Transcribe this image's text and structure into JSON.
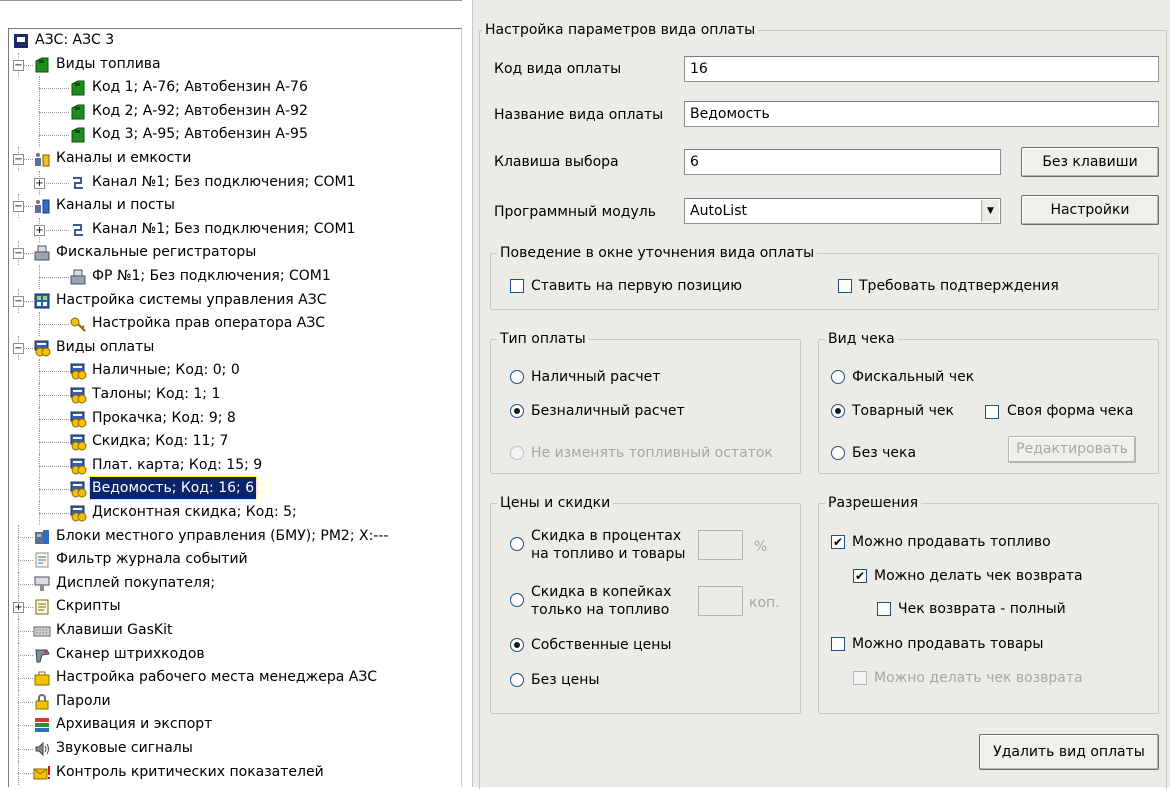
{
  "tree": {
    "items": [
      {
        "label": "АЗС: АЗС 3",
        "icon": "station-icon"
      },
      {
        "label": "Виды топлива",
        "icon": "fuel-can-icon"
      },
      {
        "label": "Код 1; А-76; Автобензин А-76",
        "icon": "fuel-can-icon"
      },
      {
        "label": "Код 2; А-92; Автобензин А-92",
        "icon": "fuel-can-icon"
      },
      {
        "label": "Код 3; А-95; Автобензин А-95",
        "icon": "fuel-can-icon"
      },
      {
        "label": "Каналы и емкости",
        "icon": "channels-tanks-icon"
      },
      {
        "label": "Канал №1; Без подключения; COM1",
        "icon": "channel-connector-icon"
      },
      {
        "label": "Каналы и посты",
        "icon": "channels-posts-icon"
      },
      {
        "label": "Канал №1; Без подключения; COM1",
        "icon": "channel-connector-icon"
      },
      {
        "label": "Фискальные регистраторы",
        "icon": "cash-register-icon"
      },
      {
        "label": "ФР №1; Без подключения; COM1",
        "icon": "cash-register-icon"
      },
      {
        "label": "Настройка системы управления АЗС",
        "icon": "control-system-icon"
      },
      {
        "label": "Настройка прав оператора АЗС",
        "icon": "key-icon"
      },
      {
        "label": "Виды оплаты",
        "icon": "payment-icon"
      },
      {
        "label": "Наличные; Код: 0; 0",
        "icon": "payment-icon"
      },
      {
        "label": "Талоны; Код: 1; 1",
        "icon": "payment-icon"
      },
      {
        "label": "Прокачка; Код: 9; 8",
        "icon": "payment-icon"
      },
      {
        "label": "Скидка; Код: 11; 7",
        "icon": "payment-icon"
      },
      {
        "label": "Плат. карта; Код: 15; 9",
        "icon": "payment-icon"
      },
      {
        "label": "Ведомость; Код: 16; 6",
        "icon": "payment-icon"
      },
      {
        "label": "Дисконтная скидка; Код: 5;",
        "icon": "payment-icon"
      },
      {
        "label": "Блоки местного управления (БМУ);  PM2;  X:---",
        "icon": "control-unit-icon"
      },
      {
        "label": "Фильтр журнала событий",
        "icon": "filter-icon"
      },
      {
        "label": "Дисплей покупателя;",
        "icon": "display-icon"
      },
      {
        "label": "Скрипты",
        "icon": "script-icon"
      },
      {
        "label": "Клавиши GasKit",
        "icon": "keyboard-icon"
      },
      {
        "label": "Сканер штрихкодов",
        "icon": "barcode-scanner-icon"
      },
      {
        "label": "Настройка рабочего места менеджера АЗС",
        "icon": "briefcase-icon"
      },
      {
        "label": "Пароли",
        "icon": "lock-icon"
      },
      {
        "label": "Архивация и экспорт",
        "icon": "archive-icon"
      },
      {
        "label": "Звуковые сигналы",
        "icon": "speaker-icon"
      },
      {
        "label": "Контроль критических показателей",
        "icon": "alert-envelope-icon"
      }
    ],
    "expander_minus": "−",
    "expander_plus": "+"
  },
  "settings": {
    "group_title": "Настройка параметров вида оплаты",
    "code_label": "Код вида оплаты",
    "code_value": "16",
    "name_label": "Название вида оплаты",
    "name_value": "Ведомость",
    "key_label": "Клавиша выбора",
    "key_value": "6",
    "no_key_button": "Без клавиши",
    "module_label": "Программный модуль",
    "module_value": "AutoList",
    "module_arrow": "▼",
    "settings_button": "Настройки",
    "behavior": {
      "title": "Поведение в окне уточнения вида оплаты",
      "first_position": "Ставить на первую позицию",
      "first_position_checked": false,
      "require_confirm": "Требовать подтверждения",
      "require_confirm_checked": false
    },
    "payment_type": {
      "title": "Тип оплаты",
      "cash": "Наличный расчет",
      "cashless": "Безналичный расчет",
      "keep_fuel": "Не изменять топливный остаток",
      "selected": "cashless"
    },
    "receipt_type": {
      "title": "Вид чека",
      "fiscal": "Фискальный чек",
      "goods": "Товарный чек",
      "own_form": "Своя форма чека",
      "own_form_checked": false,
      "none": "Без чека",
      "edit_button": "Редактировать",
      "selected": "goods"
    },
    "prices": {
      "title": "Цены и скидки",
      "percent_line1": "Скидка в процентах",
      "percent_line2": "на топливо и товары",
      "percent_unit": "%",
      "kopeck_line1": "Скидка в копейках",
      "kopeck_line2": "только на топливо",
      "kopeck_unit": "коп.",
      "own_prices": "Собственные цены",
      "no_price": "Без цены",
      "selected": "own_prices"
    },
    "permissions": {
      "title": "Разрешения",
      "sell_fuel": "Можно продавать топливо",
      "sell_fuel_checked": true,
      "return_receipt": "Можно делать чек возврата",
      "return_receipt_checked": true,
      "full_return": "Чек возврата - полный",
      "full_return_checked": false,
      "sell_goods": "Можно продавать товары",
      "sell_goods_checked": false,
      "goods_return": "Можно делать чек возврата",
      "goods_return_checked": false
    },
    "delete_button": "Удалить вид оплаты",
    "check_mark": "✔"
  },
  "colors": {
    "selection": "#0a246a",
    "panel": "#ecebe6",
    "fuel_green": "#1e8f1e",
    "payment_yellow": "#f2c200"
  }
}
